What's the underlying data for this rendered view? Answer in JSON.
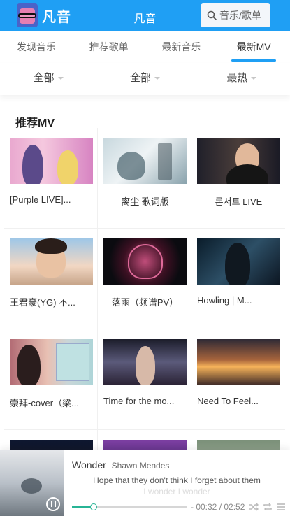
{
  "header": {
    "logo_text": "凡音",
    "title": "凡音",
    "search_label": "音乐/歌单"
  },
  "tabs": [
    {
      "label": "发现音乐"
    },
    {
      "label": "推荐歌单"
    },
    {
      "label": "最新音乐"
    },
    {
      "label": "最新MV"
    }
  ],
  "filters": [
    {
      "label": "全部"
    },
    {
      "label": "全部"
    },
    {
      "label": "最热"
    }
  ],
  "section": {
    "title": "推荐MV"
  },
  "mvs": [
    {
      "title": "[Purple LIVE]..."
    },
    {
      "title": "离尘 歌词版"
    },
    {
      "title": "론서트 LIVE"
    },
    {
      "title": "王君豪(YG) 不..."
    },
    {
      "title": "落雨（频谱PV）"
    },
    {
      "title": "Howling | M..."
    },
    {
      "title": "崇拜-cover（梁..."
    },
    {
      "title": "Time for the mo..."
    },
    {
      "title": "Need To Feel..."
    },
    {
      "title": ""
    },
    {
      "title": ""
    },
    {
      "title": ""
    }
  ],
  "player": {
    "song": "Wonder",
    "artist": "Shawn Mendes",
    "lyric_current": "Hope that they don't think I forget about them",
    "lyric_next": "I wonder I wonder",
    "time": "- 00:32 / 02:52",
    "progress": 0.19
  },
  "colors": {
    "brand": "#1f9ff4",
    "progress": "#27b495"
  }
}
